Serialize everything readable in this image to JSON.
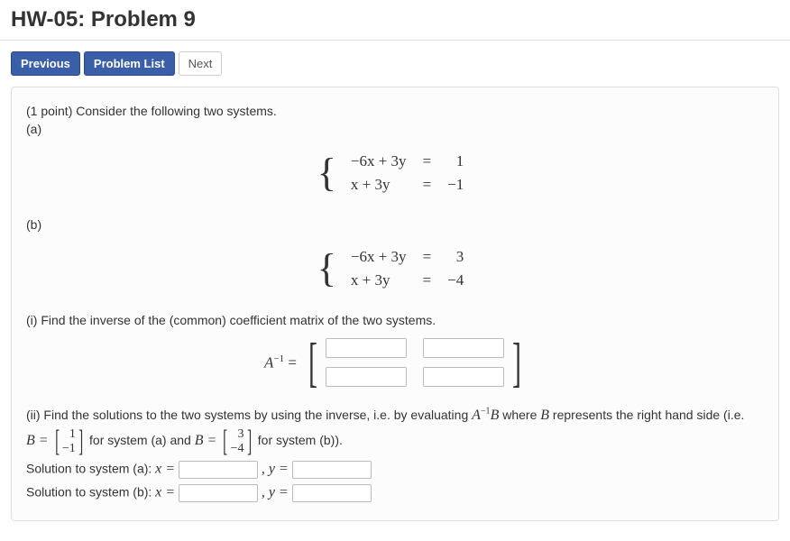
{
  "header": {
    "title": "HW-05: Problem 9"
  },
  "nav": {
    "previous": "Previous",
    "problem_list": "Problem List",
    "next": "Next"
  },
  "problem": {
    "points_intro": "(1 point) Consider the following two systems.",
    "label_a": "(a)",
    "label_b": "(b)",
    "system_a": {
      "row1_lhs": "−6x + 3y",
      "row1_eq": "=",
      "row1_rhs": "1",
      "row2_lhs": "x + 3y",
      "row2_eq": "=",
      "row2_rhs": "−1"
    },
    "system_b": {
      "row1_lhs": "−6x + 3y",
      "row1_eq": "=",
      "row1_rhs": "3",
      "row2_lhs": "x + 3y",
      "row2_eq": "=",
      "row2_rhs": "−4"
    },
    "part_i": "(i) Find the inverse of the (common) coefficient matrix of the two systems.",
    "a_inv_label_html": "A",
    "a_inv_sup": "−1",
    "a_inv_eq": " =",
    "part_ii_prefix": "(ii) Find the solutions to the two systems by using the inverse, i.e. by evaluating ",
    "eval_expr_A": "A",
    "eval_expr_sup": "−1",
    "eval_expr_B": "B",
    "part_ii_mid": " where ",
    "part_ii_B2": "B",
    "part_ii_suffix": " represents the right hand side (i.e.",
    "b_eq": "B = ",
    "vec_a_top": "1",
    "vec_a_bot": "−1",
    "for_a": " for system (a) and ",
    "b_eq2": "B = ",
    "vec_b_top": "3",
    "vec_b_bot": "−4",
    "for_b": " for system (b)).",
    "sol_a_label": "Solution to system (a): ",
    "sol_b_label": "Solution to system (b): ",
    "x_eq": "x = ",
    "y_eq": " , y = "
  }
}
